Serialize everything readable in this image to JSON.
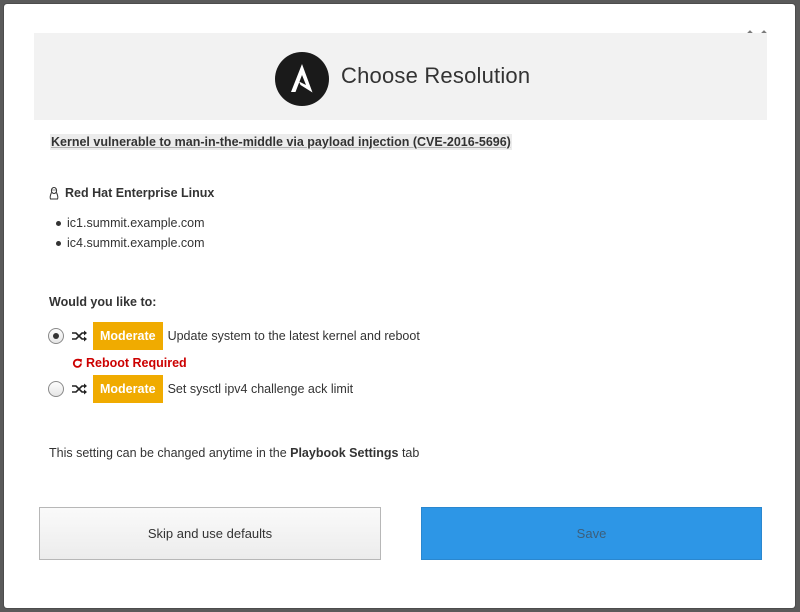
{
  "modal": {
    "title": "Choose Resolution",
    "close_icon": "close-icon",
    "logo_icon": "ansible-logo-icon"
  },
  "issue": {
    "title": "Kernel vulnerable to man-in-the-middle via payload injection (CVE-2016-5696)"
  },
  "system": {
    "os_icon": "linux-icon",
    "os_name": "Red Hat Enterprise Linux",
    "hosts": [
      "ic1.summit.example.com",
      "ic4.summit.example.com"
    ]
  },
  "question": "Would you like to:",
  "options": [
    {
      "selected": true,
      "icon": "shuffle-icon",
      "risk": "Moderate",
      "text": "Update system to the latest kernel and reboot",
      "note": "Reboot Required"
    },
    {
      "selected": false,
      "icon": "shuffle-icon",
      "risk": "Moderate",
      "text": "Set sysctl ipv4 challenge ack limit"
    }
  ],
  "footer_note": {
    "prefix": "This setting can be changed anytime in the ",
    "link": "Playbook Settings",
    "suffix": " tab"
  },
  "buttons": {
    "skip": "Skip and use defaults",
    "save": "Save"
  },
  "colors": {
    "badge": "#f0ab00",
    "reboot": "#cc0000",
    "save_button": "#2d96e6",
    "header_bg": "#f2f2f2"
  }
}
